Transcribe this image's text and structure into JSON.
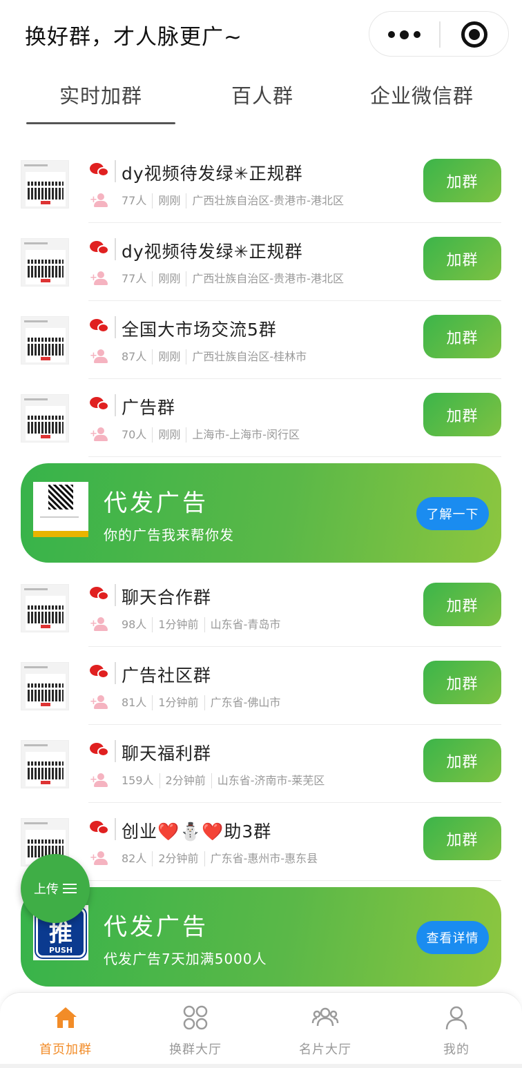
{
  "header": {
    "title": "换好群，才人脉更广~"
  },
  "tabs": [
    {
      "label": "实时加群",
      "active": true
    },
    {
      "label": "百人群",
      "active": false
    },
    {
      "label": "企业微信群",
      "active": false
    }
  ],
  "groups_top": [
    {
      "name": "dy视频待发绿✳正规群",
      "members": "77人",
      "time": "刚刚",
      "location": "广西壮族自治区-贵港市-港北区",
      "button": "加群"
    },
    {
      "name": "dy视频待发绿✳正规群",
      "members": "77人",
      "time": "刚刚",
      "location": "广西壮族自治区-贵港市-港北区",
      "button": "加群"
    },
    {
      "name": "全国大市场交流5群",
      "members": "87人",
      "time": "刚刚",
      "location": "广西壮族自治区-桂林市",
      "button": "加群"
    },
    {
      "name": "广告群",
      "members": "70人",
      "time": "刚刚",
      "location": "上海市-上海市-闵行区",
      "button": "加群"
    }
  ],
  "ad1": {
    "title": "代发广告",
    "subtitle": "你的广告我来帮你发",
    "button": "了解一下"
  },
  "groups_bottom": [
    {
      "name": "聊天合作群",
      "members": "98人",
      "time": "1分钟前",
      "location": "山东省-青岛市",
      "button": "加群"
    },
    {
      "name": "广告社区群",
      "members": "81人",
      "time": "1分钟前",
      "location": "广东省-佛山市",
      "button": "加群"
    },
    {
      "name": "聊天福利群",
      "members": "159人",
      "time": "2分钟前",
      "location": "山东省-济南市-莱芜区",
      "button": "加群"
    },
    {
      "name": "创业❤️⛄❤️助3群",
      "members": "82人",
      "time": "2分钟前",
      "location": "广东省-惠州市-惠东县",
      "button": "加群"
    }
  ],
  "ad2": {
    "title": "代发广告",
    "subtitle": "代发广告7天加满5000人",
    "button": "查看详情",
    "logo_main": "推",
    "logo_sub": "PUSH"
  },
  "fab": {
    "label": "上传"
  },
  "tabbar": [
    {
      "label": "首页加群",
      "icon": "home-icon",
      "active": true
    },
    {
      "label": "换群大厅",
      "icon": "grid-icon",
      "active": false
    },
    {
      "label": "名片大厅",
      "icon": "people-icon",
      "active": false
    },
    {
      "label": "我的",
      "icon": "user-icon",
      "active": false
    }
  ],
  "colors": {
    "accent_green": "#3cb54a",
    "accent_blue": "#1a8cf0",
    "active_orange": "#f28c28",
    "wechat_red": "#e02020"
  }
}
